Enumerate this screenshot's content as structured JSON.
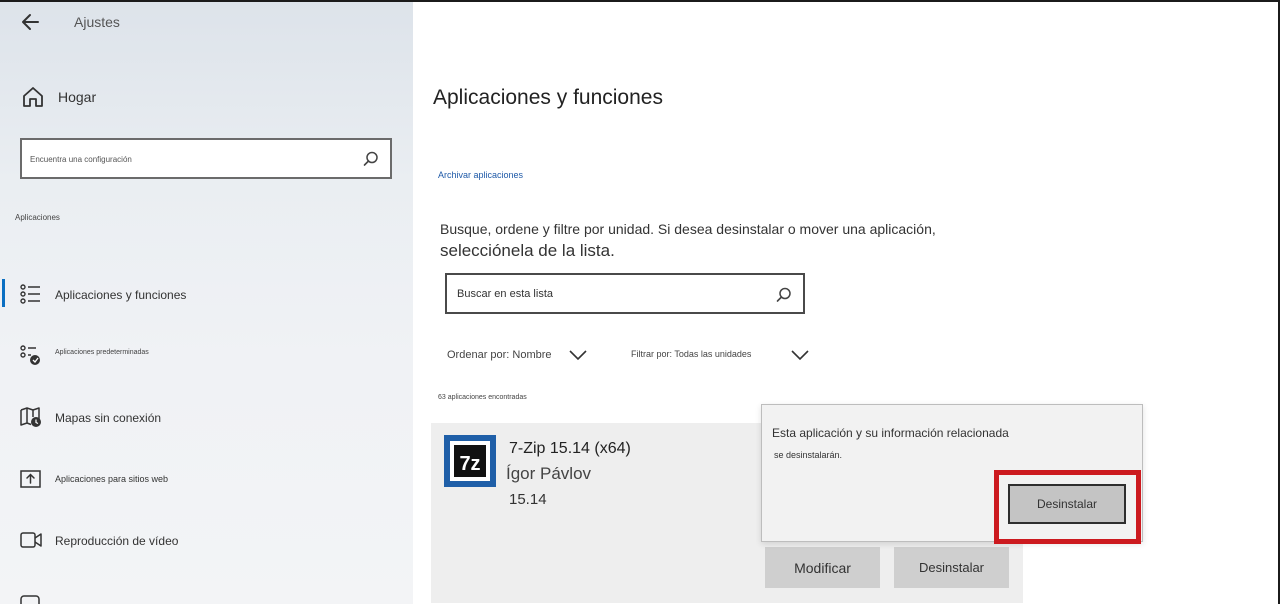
{
  "window": {
    "title": "Ajustes"
  },
  "sidebar": {
    "home_label": "Hogar",
    "search_placeholder": "Encuentra una configuración",
    "section_label": "Aplicaciones",
    "items": [
      {
        "label": "Aplicaciones y funciones",
        "icon": "apps-list-icon",
        "active": true
      },
      {
        "label": "Aplicaciones predeterminadas",
        "icon": "default-apps-icon",
        "active": false
      },
      {
        "label": "Mapas sin conexión",
        "icon": "offline-maps-icon",
        "active": false
      },
      {
        "label": "Aplicaciones para sitios web",
        "icon": "apps-for-websites-icon",
        "active": false
      },
      {
        "label": "Reproducción de vídeo",
        "icon": "video-playback-icon",
        "active": false
      }
    ]
  },
  "main": {
    "title": "Aplicaciones y funciones",
    "archive_link": "Archivar aplicaciones",
    "description_line1": "Busque, ordene y filtre por unidad. Si desea desinstalar o mover una aplicación,",
    "description_line2": "selecciónela de la lista.",
    "list_search_placeholder": "Buscar en esta lista",
    "sort_label": "Ordenar por: Nombre",
    "filter_label": "Filtrar por: Todas las unidades",
    "count_label": "63 aplicaciones encontradas",
    "app": {
      "name": "7-Zip 15.14 (x64)",
      "publisher": "Ígor Pávlov",
      "version": "15.14",
      "icon_text": "7z",
      "modify_label": "Modificar",
      "uninstall_label": "Desinstalar"
    },
    "flyout": {
      "message_line1": "Esta aplicación y su información relacionada",
      "message_line2": "se desinstalarán.",
      "confirm_label": "Desinstalar"
    }
  },
  "colors": {
    "accent": "#0a6fc2",
    "highlight": "#cc1a1f",
    "app_icon_bg": "#1f5fa8"
  }
}
